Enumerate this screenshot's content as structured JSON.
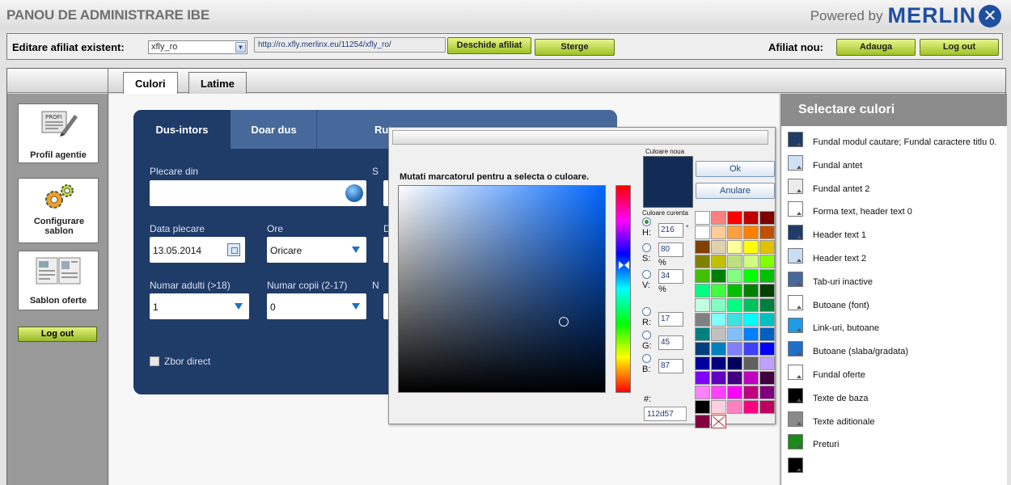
{
  "header": {
    "title": "PANOU DE ADMINISTRARE IBE",
    "powered_by": "Powered by",
    "brand": "MERLIN",
    "brand_icon": "merlin-x-logo-icon"
  },
  "toolbar": {
    "edit_label": "Editare afiliat existent:",
    "affiliate_selected": "xfly_ro",
    "url": "http://ro.xfly.merlinx.eu/11254/xfly_ro/",
    "open_button": "Deschide afiliat",
    "delete_button": "Sterge",
    "new_label": "Afiliat nou:",
    "add_button": "Adauga",
    "logout_button": "Log out"
  },
  "sidebar": {
    "items": [
      {
        "label": "Profil agentie",
        "icon": "profile-pencil-icon"
      },
      {
        "label": "Configurare sablon",
        "icon": "gears-icon"
      },
      {
        "label": "Sablon oferte",
        "icon": "document-template-icon"
      }
    ],
    "logout": "Log out"
  },
  "tabs": [
    {
      "label": "Culori",
      "active": true
    },
    {
      "label": "Latime",
      "active": false
    }
  ],
  "widget": {
    "tabs": [
      "Dus-intors",
      "Doar dus",
      "Rut"
    ],
    "tab3_partial": "Rut",
    "tab3_tail": "",
    "plecare_label": "Plecare din",
    "plecare_value": "",
    "sosire_label_partial": "S",
    "data_label": "Data plecare",
    "data_value": "13.05.2014",
    "ore_label": "Ore",
    "ore_value": "Oricare",
    "d_label_partial": "D",
    "adulti_label": "Numar adulti (>18)",
    "adulti_value": "1",
    "copii_label": "Numar copii (2-17)",
    "copii_value": "0",
    "n_label_partial": "N",
    "direct_label": "Zbor direct"
  },
  "color_picker": {
    "instruction": "Mutati marcatorul pentru a selecta o culoare.",
    "new_color_label": "Culoare noua",
    "current_color_label": "Culoare curenta",
    "ok": "Ok",
    "cancel": "Anulare",
    "hue_deg": 216,
    "H": "216",
    "H_unit": "°",
    "S": "80",
    "S_unit": "%",
    "V": "34",
    "V_unit": "%",
    "R": "17",
    "G": "45",
    "B": "87",
    "hash": "#:",
    "hex": "112d57",
    "selected_color": "#112d57",
    "marker_saturation": 0.8,
    "marker_value": 0.34,
    "palette": [
      "#ffffff",
      "#ff8080",
      "#ff0000",
      "#c00000",
      "#800000",
      "#ffffff",
      "#ffcc99",
      "#ffa040",
      "#ff8000",
      "#c05000",
      "#804000",
      "#e0d0b0",
      "#ffff99",
      "#ffff00",
      "#e0c000",
      "#808000",
      "#c0c000",
      "#c0e080",
      "#d0ff80",
      "#80ff00",
      "#40c000",
      "#008000",
      "#80ff80",
      "#00ff00",
      "#00c000",
      "#00ff80",
      "#40ff40",
      "#00c000",
      "#008000",
      "#004000",
      "#c0ffe0",
      "#80ffc0",
      "#00ff80",
      "#00c060",
      "#008040",
      "#808080",
      "#80ffff",
      "#40e0e0",
      "#00ffff",
      "#00c0c0",
      "#008080",
      "#c0c0c0",
      "#80c0ff",
      "#0080ff",
      "#0060c0",
      "#004080",
      "#0080c0",
      "#8080ff",
      "#4040ff",
      "#0000ff",
      "#0000a0",
      "#000080",
      "#000060",
      "#606060",
      "#c0a0ff",
      "#8000ff",
      "#6000c0",
      "#400080",
      "#c000c0",
      "#400040",
      "#ff80ff",
      "#ff40ff",
      "#ff00ff",
      "#c00080",
      "#800080",
      "#000000",
      "#ffd0e0",
      "#ff80c0",
      "#ff0080",
      "#c00060",
      "#800040",
      "none"
    ]
  },
  "right_panel": {
    "title": "Selectare culori",
    "items": [
      {
        "color": "#1f3b68",
        "label": "Fundal modul cautare; Fundal caractere titlu 0."
      },
      {
        "color": "#cfe2f5",
        "label": "Fundal antet"
      },
      {
        "color": "#ececec",
        "label": "Fundal antet 2"
      },
      {
        "color": "#ffffff",
        "label": "Forma text, header text 0"
      },
      {
        "color": "#1f3b68",
        "label": "Header text 1"
      },
      {
        "color": "#c8def5",
        "label": "Header text 2"
      },
      {
        "color": "#46689a",
        "label": "Tab-uri inactive"
      },
      {
        "color": "#ffffff",
        "label": "Butoane (font)"
      },
      {
        "color": "#1e9be8",
        "label": "Link-uri, butoane"
      },
      {
        "color": "#1d6fc8",
        "label": "Butoane (slaba/gradata)"
      },
      {
        "color": "#ffffff",
        "label": "Fundal oferte"
      },
      {
        "color": "#000000",
        "label": "Texte de baza"
      },
      {
        "color": "#8a8a8a",
        "label": "Texte aditionale"
      },
      {
        "color": "#1a8a1a",
        "label": "Preturi"
      },
      {
        "color": "#000000",
        "label": ""
      }
    ]
  }
}
